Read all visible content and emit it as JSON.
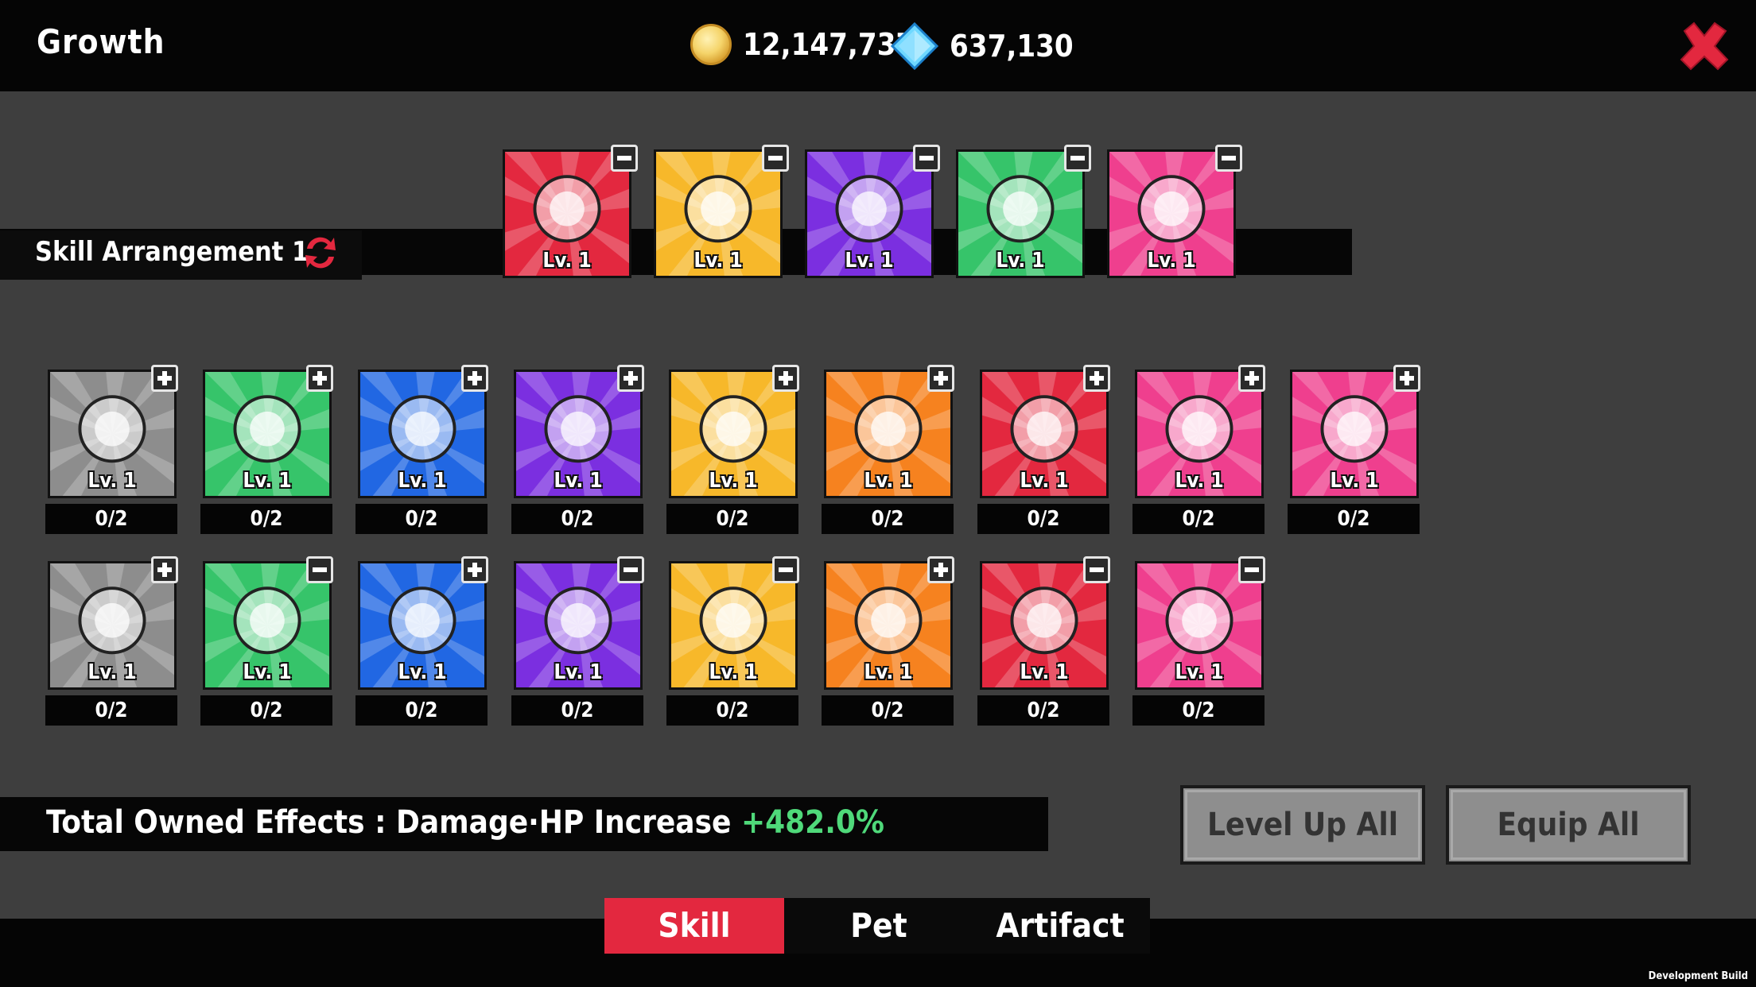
{
  "header": {
    "title": "Growth",
    "gold": "12,147,737",
    "gems": "637,130"
  },
  "arrangement": {
    "label": "Skill Arrangement 1",
    "equipped": [
      {
        "skill": "explosion",
        "level": "Lv. 1",
        "bg": "#e3283f"
      },
      {
        "skill": "cannon",
        "level": "Lv. 1",
        "bg": "#f7b82a"
      },
      {
        "skill": "shuriken",
        "level": "Lv. 1",
        "bg": "#7b2fe0"
      },
      {
        "skill": "zombie",
        "level": "Lv. 1",
        "bg": "#36c46a"
      },
      {
        "skill": "saw-blade",
        "level": "Lv. 1",
        "bg": "#ef3f8e"
      }
    ]
  },
  "skills": [
    {
      "skill": "angel-burst",
      "level": "Lv. 1",
      "count": "0/2",
      "bg": "#8d8d8d",
      "action": "plus"
    },
    {
      "skill": "meat",
      "level": "Lv. 1",
      "count": "0/2",
      "bg": "#36c46a",
      "action": "plus"
    },
    {
      "skill": "sword",
      "level": "Lv. 1",
      "count": "0/2",
      "bg": "#2167e3",
      "action": "plus"
    },
    {
      "skill": "potion",
      "level": "Lv. 1",
      "count": "0/2",
      "bg": "#7b2fe0",
      "action": "plus"
    },
    {
      "skill": "tornado",
      "level": "Lv. 1",
      "count": "0/2",
      "bg": "#f7b82a",
      "action": "plus"
    },
    {
      "skill": "storm-cloud",
      "level": "Lv. 1",
      "count": "0/2",
      "bg": "#f6821f",
      "action": "plus"
    },
    {
      "skill": "fireball",
      "level": "Lv. 1",
      "count": "0/2",
      "bg": "#e3283f",
      "action": "plus"
    },
    {
      "skill": "halo-ghost",
      "level": "Lv. 1",
      "count": "0/2",
      "bg": "#ef3f8e",
      "action": "plus"
    },
    {
      "skill": "golden-orb",
      "level": "Lv. 1",
      "count": "0/2",
      "bg": "#ef3f8e",
      "action": "plus"
    },
    {
      "skill": "poison-skull",
      "level": "Lv. 1",
      "count": "0/2",
      "bg": "#8d8d8d",
      "action": "plus"
    },
    {
      "skill": "zombie",
      "level": "Lv. 1",
      "count": "0/2",
      "bg": "#36c46a",
      "action": "minus"
    },
    {
      "skill": "magic-circle",
      "level": "Lv. 1",
      "count": "0/2",
      "bg": "#2167e3",
      "action": "plus"
    },
    {
      "skill": "shuriken",
      "level": "Lv. 1",
      "count": "0/2",
      "bg": "#7b2fe0",
      "action": "minus"
    },
    {
      "skill": "cannon",
      "level": "Lv. 1",
      "count": "0/2",
      "bg": "#f7b82a",
      "action": "minus"
    },
    {
      "skill": "shields",
      "level": "Lv. 1",
      "count": "0/2",
      "bg": "#f6821f",
      "action": "plus"
    },
    {
      "skill": "explosion",
      "level": "Lv. 1",
      "count": "0/2",
      "bg": "#e3283f",
      "action": "minus"
    },
    {
      "skill": "saw-blade",
      "level": "Lv. 1",
      "count": "0/2",
      "bg": "#ef3f8e",
      "action": "minus"
    }
  ],
  "effects": {
    "label": "Total Owned Effects : Damage·HP Increase",
    "value": "+482.0%"
  },
  "buttons": {
    "level_up_all": "Level Up All",
    "equip_all": "Equip All"
  },
  "tabs": [
    {
      "label": "Skill",
      "active": true
    },
    {
      "label": "Pet",
      "active": false
    },
    {
      "label": "Artifact",
      "active": false
    }
  ],
  "footer": {
    "dev_build": "Development Build"
  }
}
